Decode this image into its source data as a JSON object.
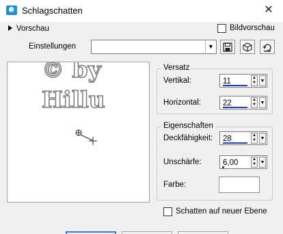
{
  "window": {
    "title": "Schlagschatten",
    "close_label": "✕"
  },
  "preview_toggle": {
    "label": "Vorschau"
  },
  "image_preview": {
    "label": "Bildvorschau",
    "checked": false
  },
  "settings": {
    "label": "Einstellungen",
    "value": ""
  },
  "preview": {
    "watermark_line1": "© by",
    "watermark_line2": "Hillu"
  },
  "offset": {
    "group_title": "Versatz",
    "vertical_label": "Vertikal:",
    "vertical_value": "11",
    "horizontal_label": "Horizontal:",
    "horizontal_value": "22"
  },
  "properties": {
    "group_title": "Eigenschaften",
    "opacity_label": "Deckfähigkeit:",
    "opacity_value": "28",
    "blur_label": "Unschärfe:",
    "blur_value": "6,00",
    "color_label": "Farbe:",
    "color": "#ffffff"
  },
  "new_layer": {
    "label": "Schatten auf neuer Ebene",
    "checked": false
  },
  "colors": {
    "accent": "#1d3fc2",
    "icon": "#1e8fd6"
  },
  "icons": [
    "app-icon",
    "close-icon",
    "expand-arrow-icon",
    "dropdown-arrow-icon",
    "save-preset-icon",
    "cube-icon",
    "reset-icon",
    "crosshair-icon",
    "spin-up-icon",
    "spin-down-icon"
  ]
}
